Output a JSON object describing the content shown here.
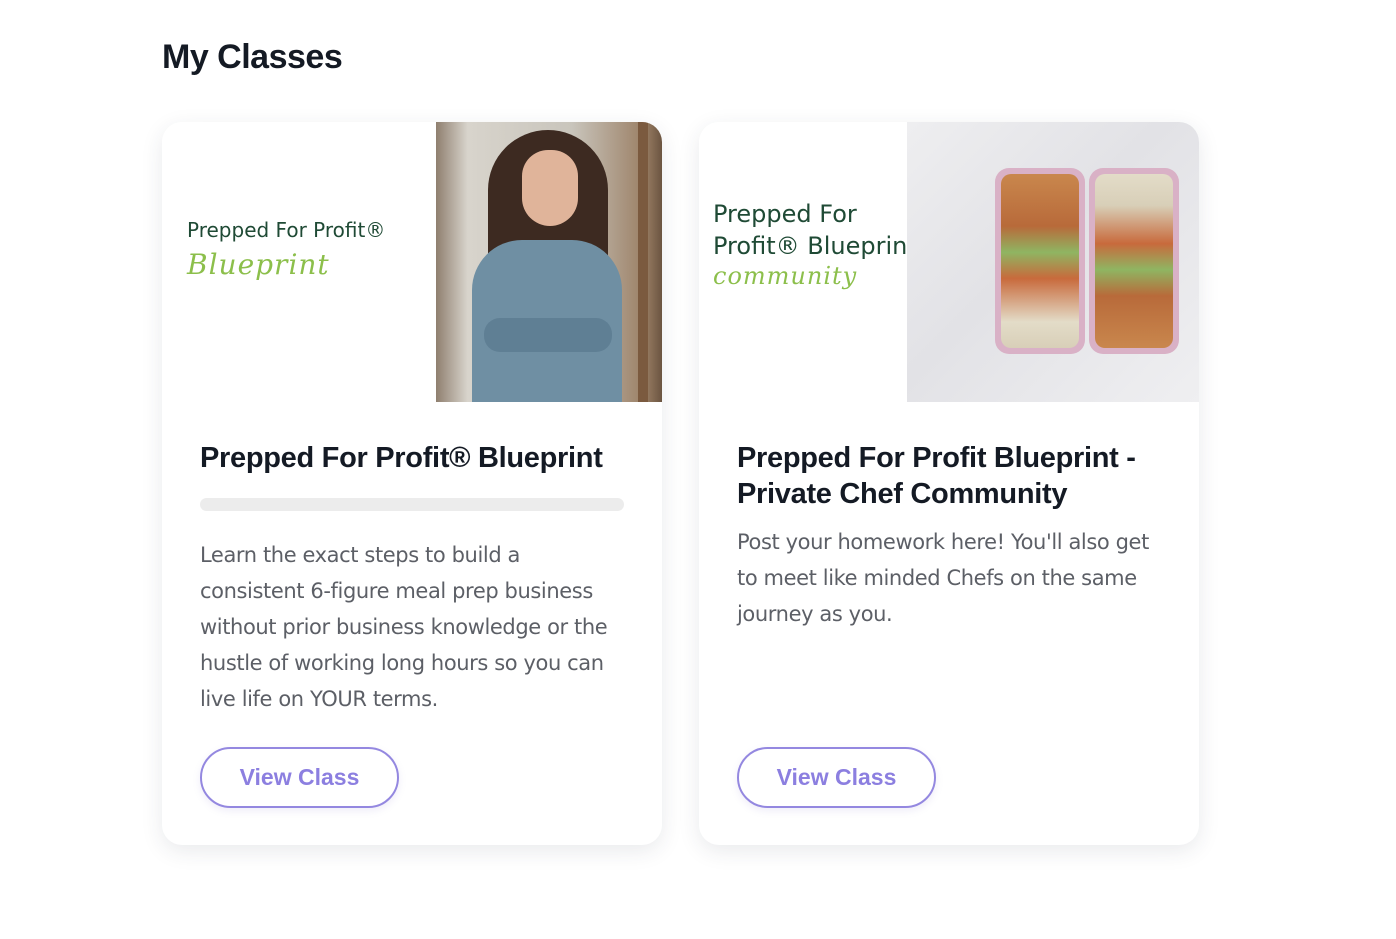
{
  "page": {
    "title": "My Classes"
  },
  "classes": [
    {
      "thumbnail": {
        "line1": "Prepped For Profit®",
        "script": "Blueprint"
      },
      "title": "Prepped For Profit® Blueprint",
      "progress_percent": 0,
      "description": "Learn the exact steps to build a consistent 6-figure meal prep business without prior business knowledge or the hustle of working long hours so you can live life on YOUR terms.",
      "button_label": "View Class"
    },
    {
      "thumbnail": {
        "line1": "Prepped For",
        "line2": "Profit® Blueprint",
        "script": "community"
      },
      "title": "Prepped For Profit Blueprint - Private Chef Community",
      "description": "Post your homework here! You'll also get to meet like minded Chefs on the same journey as you.",
      "button_label": "View Class"
    }
  ],
  "colors": {
    "accent": "#8c7fe0",
    "brand_green": "#1f4a35",
    "script_green": "#8cbf4b"
  }
}
